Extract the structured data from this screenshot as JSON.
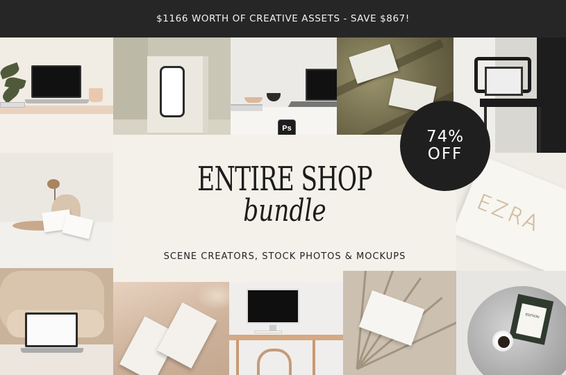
{
  "banner": {
    "text": "$1166 WORTH OF CREATIVE ASSETS - SAVE $867!"
  },
  "center": {
    "title": "ENTIRE SHOP",
    "subtitle": "bundle",
    "tagline": "SCENE CREATORS, STOCK PHOTOS & MOCKUPS"
  },
  "badge": {
    "percent": "74%",
    "label": "OFF"
  },
  "tiles": {
    "photoshop_icon": {
      "icon": "photoshop-icon",
      "label": "Ps"
    },
    "ezra_card": {
      "text": "EZRA"
    },
    "packet_card": {
      "text": "EDITION"
    }
  },
  "colors": {
    "banner_bg": "#262626",
    "center_bg": "#f4f1ea",
    "badge_bg": "#1f1f1f",
    "text_dark": "#1c1c1c"
  }
}
